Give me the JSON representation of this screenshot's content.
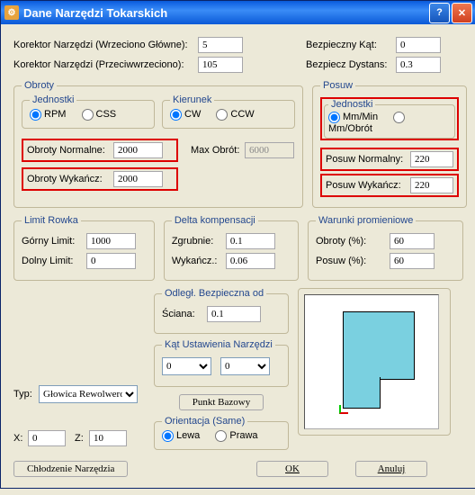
{
  "title": "Dane Narzędzi Tokarskich",
  "top": {
    "kor_glowne_lbl": "Korektor Narzędzi (Wrzeciono Główne):",
    "kor_glowne_val": "5",
    "kor_przeciw_lbl": "Korektor Narzędzi (Przeciwwrzeciono):",
    "kor_przeciw_val": "105",
    "bezp_kat_lbl": "Bezpieczny Kąt:",
    "bezp_kat_val": "0",
    "bezp_dyst_lbl": "Bezpiecz Dystans:",
    "bezp_dyst_val": "0.3"
  },
  "obroty": {
    "legend": "Obroty",
    "jednostki_legend": "Jednostki",
    "rpm": "RPM",
    "css": "CSS",
    "kierunek_legend": "Kierunek",
    "cw": "CW",
    "ccw": "CCW",
    "norm_lbl": "Obroty Normalne:",
    "norm_val": "2000",
    "max_lbl": "Max Obrót:",
    "max_val": "6000",
    "wyk_lbl": "Obroty Wykańcz:",
    "wyk_val": "2000"
  },
  "posuw": {
    "legend": "Posuw",
    "jednostki_legend": "Jednostki",
    "mmmin": "Mm/Min",
    "mmobr": "Mm/Obrót",
    "norm_lbl": "Posuw Normalny:",
    "norm_val": "220",
    "wyk_lbl": "Posuw Wykańcz:",
    "wyk_val": "220"
  },
  "limit": {
    "legend": "Limit Rowka",
    "gorny_lbl": "Górny Limit:",
    "gorny_val": "1000",
    "dolny_lbl": "Dolny Limit:",
    "dolny_val": "0"
  },
  "delta": {
    "legend": "Delta kompensacji",
    "zgr_lbl": "Zgrubnie:",
    "zgr_val": "0.1",
    "wyk_lbl": "Wykańcz.:",
    "wyk_val": "0.06"
  },
  "warunki": {
    "legend": "Warunki promieniowe",
    "obr_lbl": "Obroty (%):",
    "obr_val": "60",
    "pos_lbl": "Posuw (%):",
    "pos_val": "60"
  },
  "odlegl": {
    "legend": "Odległ. Bezpieczna od",
    "sciana_lbl": "Ściana:",
    "sciana_val": "0.1"
  },
  "kat_ust": {
    "legend": "Kąt Ustawienia Narzędzi",
    "a_val": "0",
    "b_val": "0"
  },
  "typ": {
    "lbl": "Typ:",
    "val": "Głowica Rewolwero"
  },
  "punkt_bazowy": "Punkt Bazowy",
  "orientacja": {
    "legend": "Orientacja (Same)",
    "lewa": "Lewa",
    "prawa": "Prawa"
  },
  "xz": {
    "x_lbl": "X:",
    "x_val": "0",
    "z_lbl": "Z:",
    "z_val": "10"
  },
  "buttons": {
    "chlodzenie": "Chłodzenie Narzędzia",
    "ok": "OK",
    "anuluj": "Anuluj"
  }
}
